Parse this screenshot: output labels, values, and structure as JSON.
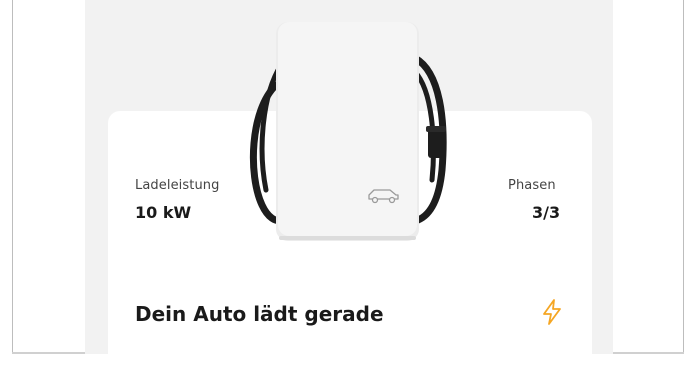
{
  "charger": {
    "leistung_label": "Ladeleistung",
    "leistung_value": "10 kW",
    "phasen_label": "Phasen",
    "phasen_value": "3/3"
  },
  "status": {
    "text": "Dein Auto lädt gerade",
    "icon": "bolt-icon",
    "icon_color": "#f5a623"
  },
  "colors": {
    "app_background": "#f2f2f2",
    "card_background": "#ffffff"
  }
}
